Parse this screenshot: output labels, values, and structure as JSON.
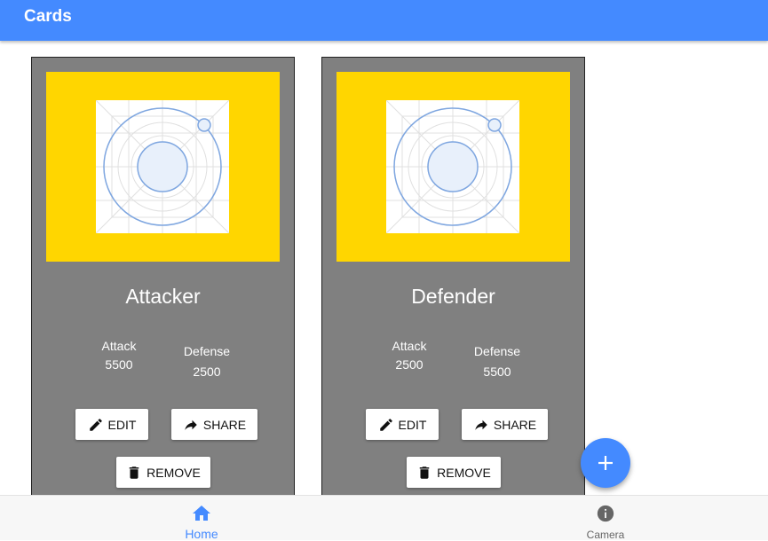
{
  "app": {
    "title": "Cards"
  },
  "cards": [
    {
      "title": "Attacker",
      "attack_label": "Attack",
      "attack_value": "5500",
      "defense_label": "Defense",
      "defense_value": "2500",
      "edit_label": "EDIT",
      "share_label": "SHARE",
      "remove_label": "REMOVE"
    },
    {
      "title": "Defender",
      "attack_label": "Attack",
      "attack_value": "2500",
      "defense_label": "Defense",
      "defense_value": "5500",
      "edit_label": "EDIT",
      "share_label": "SHARE",
      "remove_label": "REMOVE"
    }
  ],
  "bottom_nav": {
    "items": [
      {
        "label": "Home",
        "icon": "home-icon",
        "active": true
      },
      {
        "label": "Camera",
        "icon": "info-icon",
        "active": false
      }
    ]
  },
  "fab": {
    "icon": "add-icon"
  },
  "colors": {
    "primary": "#448aff",
    "card": "#808080",
    "image_bg": "#ffd600",
    "nav_inactive": "#666666"
  }
}
